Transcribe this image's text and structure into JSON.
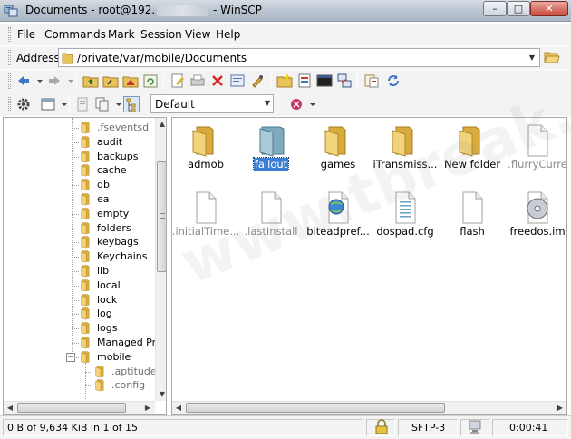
{
  "window": {
    "title_prefix": "Documents - root@192.",
    "title_suffix": "- WinSCP",
    "minimize_glyph": "–",
    "maximize_glyph": "□",
    "close_glyph": "✕"
  },
  "menu": {
    "items": [
      "File",
      "Commands",
      "Mark",
      "Session",
      "View",
      "Help"
    ]
  },
  "address": {
    "label": "Address",
    "path": "/private/var/mobile/Documents"
  },
  "toolbar": {
    "profile": "Default"
  },
  "tree": {
    "items": [
      {
        "label": ".fseventsd",
        "hidden": true
      },
      {
        "label": "audit",
        "hidden": false
      },
      {
        "label": "backups",
        "hidden": false
      },
      {
        "label": "cache",
        "hidden": false
      },
      {
        "label": "db",
        "hidden": false
      },
      {
        "label": "ea",
        "hidden": false
      },
      {
        "label": "empty",
        "hidden": false
      },
      {
        "label": "folders",
        "hidden": false
      },
      {
        "label": "keybags",
        "hidden": false
      },
      {
        "label": "Keychains",
        "hidden": false
      },
      {
        "label": "lib",
        "hidden": false
      },
      {
        "label": "local",
        "hidden": false
      },
      {
        "label": "lock",
        "hidden": false
      },
      {
        "label": "log",
        "hidden": false
      },
      {
        "label": "logs",
        "hidden": false
      },
      {
        "label": "Managed Pr",
        "hidden": false
      },
      {
        "label": "mobile",
        "hidden": false
      },
      {
        "label": ".aptitude",
        "hidden": true
      },
      {
        "label": ".config",
        "hidden": true
      }
    ],
    "collapse_glyph": "−"
  },
  "files": {
    "items": [
      {
        "name": "admob",
        "type": "folder",
        "hidden": false,
        "selected": false
      },
      {
        "name": "fallout",
        "type": "folder-open",
        "hidden": false,
        "selected": true
      },
      {
        "name": "games",
        "type": "folder",
        "hidden": false,
        "selected": false
      },
      {
        "name": "iTransmiss...",
        "type": "folder",
        "hidden": false,
        "selected": false
      },
      {
        "name": "New folder",
        "type": "folder",
        "hidden": false,
        "selected": false
      },
      {
        "name": ".flurryCurre",
        "type": "file",
        "hidden": true,
        "selected": false
      },
      {
        "name": ".initialTime...",
        "type": "file",
        "hidden": true,
        "selected": false
      },
      {
        "name": ".lastInstall",
        "type": "file",
        "hidden": true,
        "selected": false
      },
      {
        "name": "biteadpref...",
        "type": "globe-file",
        "hidden": false,
        "selected": false
      },
      {
        "name": "dospad.cfg",
        "type": "cfg-file",
        "hidden": false,
        "selected": false
      },
      {
        "name": "flash",
        "type": "file",
        "hidden": false,
        "selected": false
      },
      {
        "name": "freedos.im",
        "type": "disk-file",
        "hidden": false,
        "selected": false
      }
    ]
  },
  "watermark": "www.tbreak.com",
  "status": {
    "selection": "0 B of 9,634 KiB in 1 of 15",
    "protocol": "SFTP-3",
    "time": "0:00:41"
  },
  "colors": {
    "folder": "#e8c25a",
    "selection": "#3b7fd5",
    "hidden_text": "#8a8a8a"
  }
}
